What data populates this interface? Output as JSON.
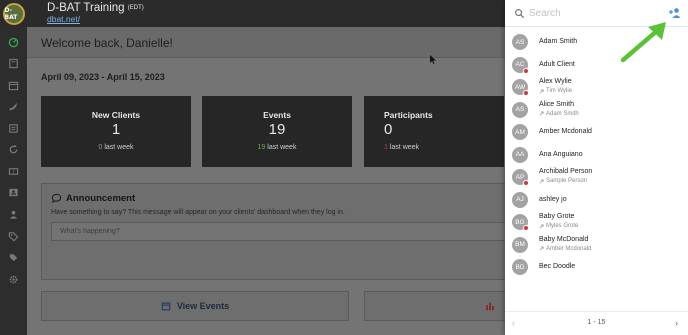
{
  "app": {
    "title": "D-BAT Training",
    "timezone": "(EDT)",
    "url": "dbat.net/",
    "logo_text": "D-BAT"
  },
  "nav": {
    "icons": [
      "dashboard-icon",
      "book-icon",
      "calendar-icon",
      "rocket-icon",
      "list-icon",
      "refresh-icon",
      "ticket-icon",
      "contact-card-icon",
      "users-icon",
      "tag-icon",
      "tags-icon",
      "gear-icon"
    ]
  },
  "welcome": "Welcome back, Danielle!",
  "date_range": "April 09, 2023 - April 15, 2023",
  "stats": [
    {
      "title": "New Clients",
      "value": "1",
      "delta": "0",
      "delta_suffix": " last week",
      "delta_color": "#8aa080"
    },
    {
      "title": "Events",
      "value": "19",
      "delta": "19",
      "delta_suffix": " last week",
      "delta_color": "#6aaa55"
    },
    {
      "title": "Participants",
      "value": "0",
      "delta": "1",
      "delta_suffix": " last week",
      "delta_color": "#c74242"
    }
  ],
  "announcement": {
    "title": "Announcement",
    "description": "Have something to say? This message will appear on your clients' dashboard when they log in.",
    "placeholder": "What's happening?"
  },
  "buttons": {
    "view_events": "View Events"
  },
  "drawer": {
    "search_placeholder": "Search",
    "contacts": [
      {
        "initials": "AS",
        "name": "Adam Smith",
        "sub": "",
        "badge": false
      },
      {
        "initials": "AC",
        "name": "Adult Client",
        "sub": "",
        "badge": true
      },
      {
        "initials": "AW",
        "name": "Alex Wylie",
        "sub": "Tim Wylie",
        "badge": true
      },
      {
        "initials": "AS",
        "name": "Alice Smith",
        "sub": "Adam Smith",
        "badge": false
      },
      {
        "initials": "AM",
        "name": "Amber Mcdonald",
        "sub": "",
        "badge": false
      },
      {
        "initials": "AA",
        "name": "Ana Anguiano",
        "sub": "",
        "badge": false
      },
      {
        "initials": "AP",
        "name": "Archibald Person",
        "sub": "Sample Person",
        "badge": true
      },
      {
        "initials": "AJ",
        "name": "ashley jo",
        "sub": "",
        "badge": false
      },
      {
        "initials": "BG",
        "name": "Baby Grote",
        "sub": "Myles Grote",
        "badge": true
      },
      {
        "initials": "BM",
        "name": "Baby McDonald",
        "sub": "Amber Mcdonald",
        "badge": false
      },
      {
        "initials": "BD",
        "name": "Bec Doodle",
        "sub": "",
        "badge": false
      }
    ],
    "pager": {
      "prev": "‹",
      "text": "1 - 15",
      "next": "›"
    }
  },
  "colors": {
    "accent_green": "#5bc236",
    "badge_red": "#d33636",
    "link_blue": "#4a90d9"
  }
}
